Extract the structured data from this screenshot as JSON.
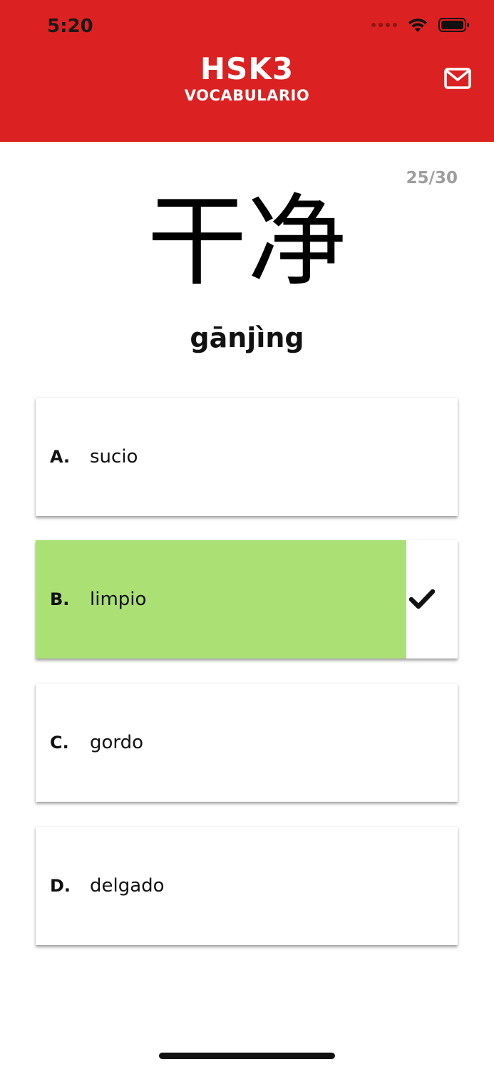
{
  "status_bar": {
    "time": "5:20"
  },
  "header": {
    "title": "HSK3",
    "subtitle": "VOCABULARIO",
    "mail_icon": "mail-icon",
    "background_color": "#db2121"
  },
  "quiz": {
    "progress": "25/30",
    "hanzi": "干净",
    "pinyin": "gānjìng",
    "options": [
      {
        "letter": "A.",
        "text": "sucio"
      },
      {
        "letter": "B.",
        "text": "limpio",
        "correct": true,
        "result_icon": "checkmark-icon",
        "fill_color": "#abe074"
      },
      {
        "letter": "C.",
        "text": "gordo"
      },
      {
        "letter": "D.",
        "text": "delgado"
      }
    ]
  }
}
